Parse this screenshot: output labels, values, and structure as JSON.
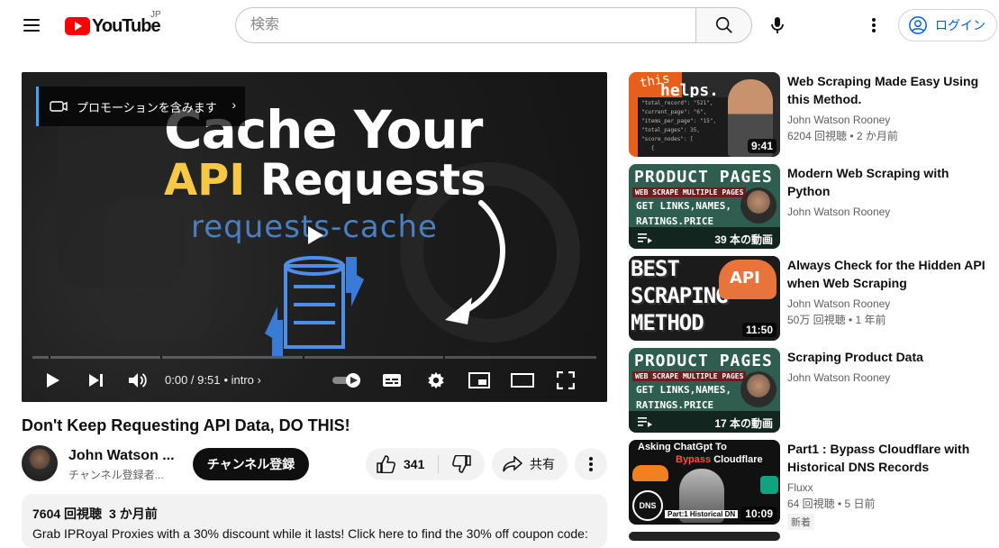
{
  "header": {
    "logo_text": "YouTube",
    "region": "JP",
    "search_placeholder": "検索",
    "login_label": "ログイン"
  },
  "player": {
    "promo_label": "プロモーションを含みます",
    "thumb_line1": "Cache Your",
    "thumb_line2_highlight": "API",
    "thumb_line2_rest": " Requests",
    "thumb_line3": "requests-cache",
    "time": "0:00 / 9:51",
    "chapter": "• intro",
    "progress_fraction": 0.0
  },
  "video": {
    "title": "Don't Keep Requesting API Data, DO THIS!",
    "channel": "John Watson ...",
    "subscribers": "チャンネル登録者...",
    "subscribe_label": "チャンネル登録",
    "likes": "341",
    "share_label": "共有",
    "views": "7604 回視聴",
    "date": "3 か月前",
    "description": "Grab IPRoyal Proxies with a 30% discount while it lasts! Click here to find the 30% off coupon code:"
  },
  "sidebar": {
    "items": [
      {
        "title": "Web Scraping Made Easy Using this Method.",
        "channel": "John Watson Rooney",
        "meta": "6204 回視聴 • 2 か月前",
        "duration": "9:41",
        "thumb_word": "this",
        "thumb_big": "helps."
      },
      {
        "title": "Modern Web Scraping with Python",
        "channel": "John Watson Rooney",
        "meta": "",
        "playlist_count": "39 本の動画",
        "thumb_pp": "PRODUCT PAGES",
        "thumb_bar": "WEB SCRAPE MULTIPLE PAGES",
        "thumb_l1": "GET LINKS,NAMES,",
        "thumb_l2": "RATINGS.PRICE"
      },
      {
        "title": "Always Check for the Hidden API when Web Scraping",
        "channel": "John Watson Rooney",
        "meta": "50万 回視聴 • 1 年前",
        "duration": "11:50",
        "thumb_w1": "BEST",
        "thumb_w2": "SCRAPING",
        "thumb_w3": "METHOD",
        "thumb_api": "API"
      },
      {
        "title": "Scraping Product Data",
        "channel": "John Watson Rooney",
        "meta": "",
        "playlist_count": "17 本の動画",
        "thumb_pp": "PRODUCT PAGES",
        "thumb_bar": "WEB SCRAPE MULTIPLE PAGES",
        "thumb_l1": "GET LINKS,NAMES,",
        "thumb_l2": "RATINGS.PRICE"
      },
      {
        "title": "Part1 : Bypass Cloudflare with Historical DNS Records",
        "channel": "Fluxx",
        "meta": "64 回視聴 • 5 日前",
        "badge": "新着",
        "duration": "10:09",
        "thumb_ask": "Asking ChatGpt To",
        "thumb_bypass_red": "Bypass",
        "thumb_bypass_rest": " Cloudflare",
        "thumb_dns": "DNS",
        "thumb_part": "Part:1  Historical DN"
      }
    ]
  },
  "colors": {
    "brand_red": "#ff0000",
    "link_blue": "#065fd4",
    "promo_accent": "#3ea6ff",
    "api_yellow": "#f7c843"
  }
}
